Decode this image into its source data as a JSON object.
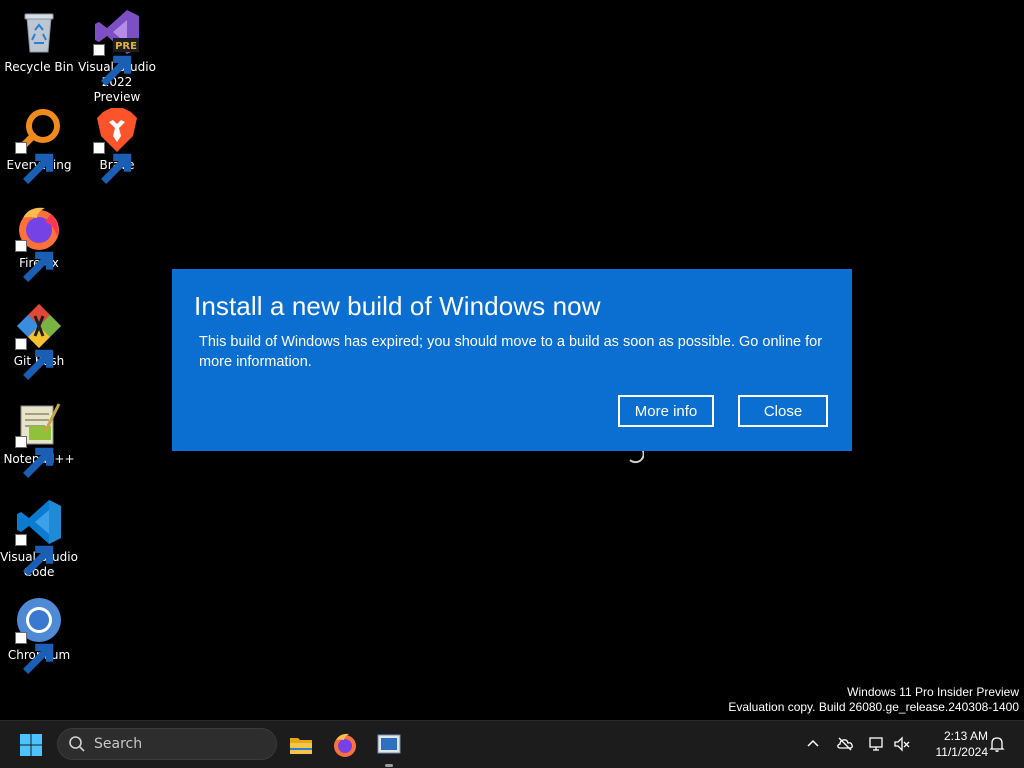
{
  "desktop": {
    "icons": [
      {
        "label": "Recycle Bin",
        "icon": "recycle-bin-icon",
        "shortcut": false
      },
      {
        "label": "Visual Studio\n2022 Preview",
        "icon": "visual-studio-preview-icon",
        "shortcut": true,
        "badge": "PRE"
      },
      {
        "label": "Everything",
        "icon": "everything-search-icon",
        "shortcut": true
      },
      {
        "label": "Brave",
        "icon": "brave-browser-icon",
        "shortcut": true
      },
      {
        "label": "Firefox",
        "icon": "firefox-icon",
        "shortcut": true
      },
      {
        "label": "Git Bash",
        "icon": "git-bash-icon",
        "shortcut": true
      },
      {
        "label": "Notepad++",
        "icon": "notepad-plus-plus-icon",
        "shortcut": true
      },
      {
        "label": "Visual Studio\nCode",
        "icon": "vscode-icon",
        "shortcut": true
      },
      {
        "label": "Chromium",
        "icon": "chromium-icon",
        "shortcut": true
      }
    ]
  },
  "dialog": {
    "title": "Install a new build of Windows now",
    "body": "This build of Windows has expired; you should move to a build as soon as possible. Go online for more information.",
    "more_info_label": "More info",
    "close_label": "Close",
    "background": "#0a6fd0"
  },
  "watermark": {
    "line1": "Windows 11 Pro Insider Preview",
    "line2": "Evaluation copy. Build 26080.ge_release.240308-1400"
  },
  "taskbar": {
    "search_placeholder": "Search",
    "pinned": [
      {
        "name": "file-explorer-icon"
      },
      {
        "name": "firefox-icon"
      },
      {
        "name": "active-window-app-icon",
        "running": true
      }
    ],
    "tray": [
      "chevron-up-icon",
      "onedrive-offline-icon",
      "network-icon",
      "volume-muted-icon",
      "notification-bell-icon"
    ],
    "clock": {
      "time": "2:13 AM",
      "date": "11/1/2024"
    }
  },
  "colors": {
    "desktop_bg": "#000000",
    "taskbar_bg": "#1c1c1c",
    "windows_accent": "#0078d4"
  }
}
